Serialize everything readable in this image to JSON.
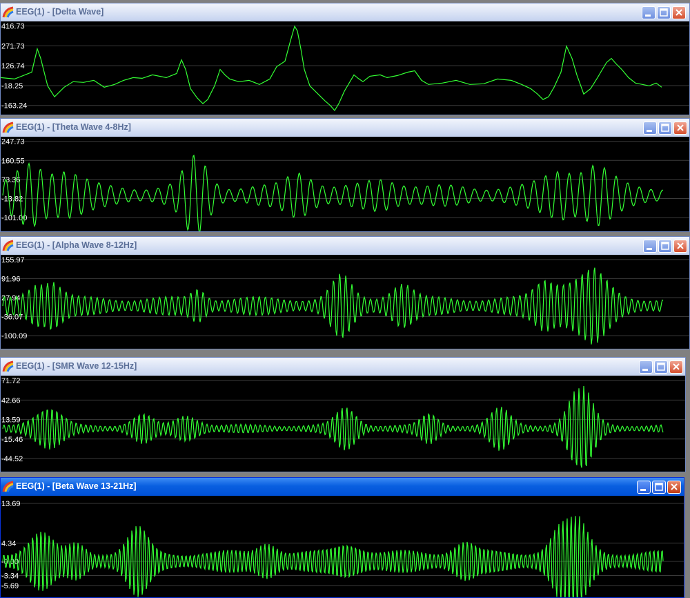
{
  "colors": {
    "trace": "#33ff33",
    "grid": "#3a3a3a",
    "plot_bg": "#000000",
    "label": "#ffffff"
  },
  "window_buttons": [
    "minimize-icon",
    "maximize-icon",
    "close-icon"
  ],
  "windows": [
    {
      "title": "EEG(1) - [Delta Wave]",
      "active": false,
      "chart_data": {
        "type": "line",
        "y_tick_labels": [
          "416.73",
          "271.73",
          "126.74",
          "-18.25",
          "-163.24"
        ],
        "y_ticks": [
          416.73,
          271.73,
          126.74,
          -18.25,
          -163.24
        ],
        "ylim": [
          -200,
          420
        ],
        "series": [
          {
            "x": [
              0,
              20,
              45,
              53,
              58,
              68,
              78,
              92,
              105,
              120,
              135,
              150,
              165,
              178,
              192,
              205,
              220,
              240,
              255,
              262,
              268,
              275,
              285,
              293,
              300,
              310,
              318,
              325,
              332,
              345,
              360,
              375,
              390,
              400,
              412,
              420,
              426,
              430,
              435,
              440,
              448,
              460,
              470,
              478,
              484,
              490,
              498,
              505,
              512,
              518,
              525,
              535,
              550,
              560,
              575,
              590,
              600,
              610,
              620,
              640,
              660,
              680,
              700,
              720,
              740,
              755,
              768,
              778,
              786,
              794,
              802,
              812,
              820,
              828,
              835,
              845,
              855,
              865,
              872,
              878,
              885,
              892,
              900,
              910,
              920,
              930,
              940,
              950,
              958
            ],
            "y": [
              40,
              30,
              80,
              250,
              180,
              -20,
              -100,
              -30,
              10,
              5,
              20,
              -30,
              -10,
              20,
              40,
              35,
              60,
              40,
              70,
              170,
              100,
              -40,
              -110,
              -150,
              -120,
              -20,
              100,
              60,
              30,
              10,
              20,
              -10,
              30,
              120,
              160,
              310,
              415,
              380,
              250,
              100,
              -20,
              -80,
              -130,
              -165,
              -200,
              -150,
              -60,
              0,
              60,
              35,
              10,
              50,
              60,
              40,
              55,
              80,
              90,
              20,
              -10,
              0,
              20,
              -10,
              -5,
              30,
              20,
              -10,
              -40,
              -80,
              -120,
              -100,
              -30,
              80,
              270,
              180,
              60,
              -80,
              -40,
              40,
              100,
              150,
              180,
              140,
              100,
              40,
              0,
              -10,
              -20,
              0,
              -30
            ]
          }
        ]
      }
    },
    {
      "title": "EEG(1) - [Theta Wave 4-8Hz]",
      "active": false,
      "chart_data": {
        "type": "line",
        "y_tick_labels": [
          "247.73",
          "160.55",
          "73.36",
          "-13.82",
          "-101.00"
        ],
        "y_ticks": [
          247.73,
          160.55,
          73.36,
          -13.82,
          -101.0
        ],
        "ylim": [
          -145,
          250
        ],
        "series": [
          {
            "name": "",
            "period_samples": 17
          }
        ]
      }
    },
    {
      "title": "EEG(1) - [Alpha Wave 8-12Hz]",
      "active": false,
      "chart_data": {
        "type": "line",
        "y_tick_labels": [
          "155.97",
          "91.96",
          "27.94",
          "-36.07",
          "-100.09"
        ],
        "y_ticks": [
          155.97,
          91.96,
          27.94,
          -36.07,
          -100.09
        ],
        "ylim": [
          -130,
          158
        ],
        "series": [
          {
            "name": "",
            "period_samples": 9
          }
        ]
      }
    },
    {
      "title": "EEG(1) - [SMR Wave 12-15Hz]",
      "active": false,
      "chart_data": {
        "type": "line",
        "y_tick_labels": [
          "71.72",
          "42.66",
          "13.59",
          "-15.46",
          "-44.52"
        ],
        "y_ticks": [
          71.72,
          42.66,
          13.59,
          -15.46,
          -44.52
        ],
        "ylim": [
          -58,
          73
        ],
        "series": [
          {
            "name": "",
            "period_samples": 7
          }
        ]
      }
    },
    {
      "title": "EEG(1) - [Beta Wave 13-21Hz]",
      "active": true,
      "chart_data": {
        "type": "line",
        "y_tick_labels": [
          "13.69",
          "4.34",
          "-0.00",
          "-3.34",
          "-5.69"
        ],
        "y_ticks": [
          13.69,
          4.34,
          0.0,
          -3.34,
          -5.69
        ],
        "ylim": [
          -7.5,
          14.5
        ],
        "series": [
          {
            "name": "",
            "period_samples": 6
          }
        ]
      }
    }
  ]
}
